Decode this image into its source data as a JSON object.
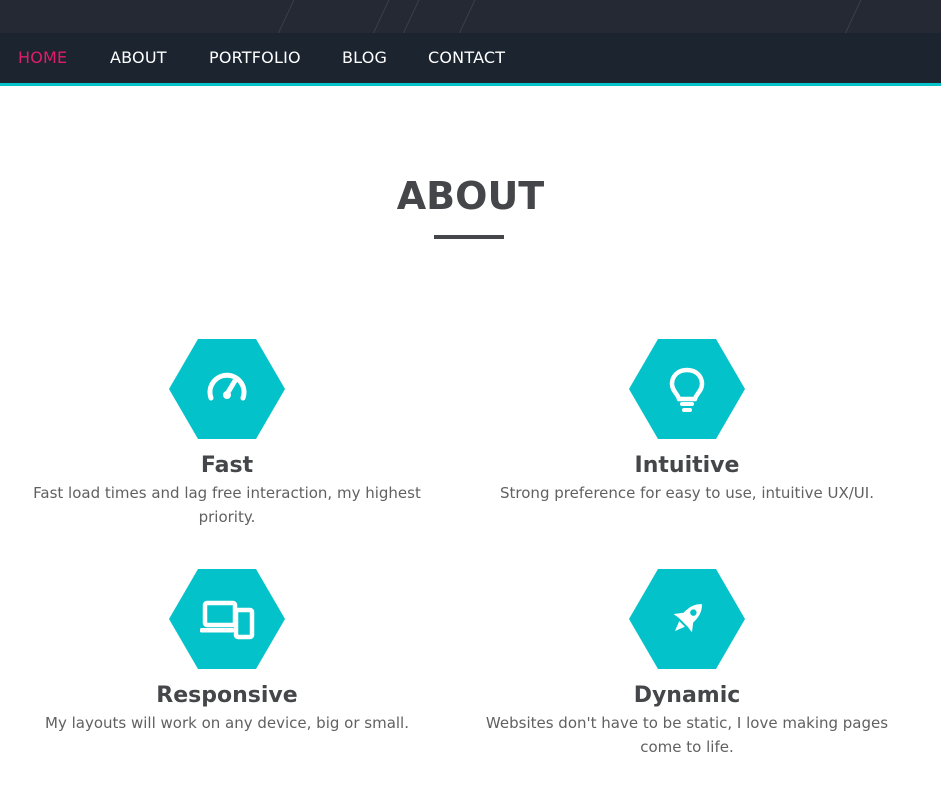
{
  "nav": {
    "items": [
      {
        "label": "HOME",
        "active": true
      },
      {
        "label": "ABOUT",
        "active": false
      },
      {
        "label": "PORTFOLIO",
        "active": false
      },
      {
        "label": "BLOG",
        "active": false
      },
      {
        "label": "CONTACT",
        "active": false
      }
    ]
  },
  "about": {
    "title": "ABOUT",
    "features": [
      {
        "icon": "speedometer-icon",
        "title": "Fast",
        "description": "Fast load times and lag free interaction, my highest priority."
      },
      {
        "icon": "lightbulb-icon",
        "title": "Intuitive",
        "description": "Strong preference for easy to use, intuitive UX/UI."
      },
      {
        "icon": "devices-icon",
        "title": "Responsive",
        "description": "My layouts will work on any device, big or small."
      },
      {
        "icon": "rocket-icon",
        "title": "Dynamic",
        "description": "Websites don't have to be static, I love making pages come to life."
      }
    ]
  },
  "colors": {
    "accent": "#04c2c9",
    "active_nav": "#e31b6d",
    "nav_background": "#1b242f",
    "top_strip": "#252934",
    "heading": "#444649",
    "body_text": "#616161"
  }
}
